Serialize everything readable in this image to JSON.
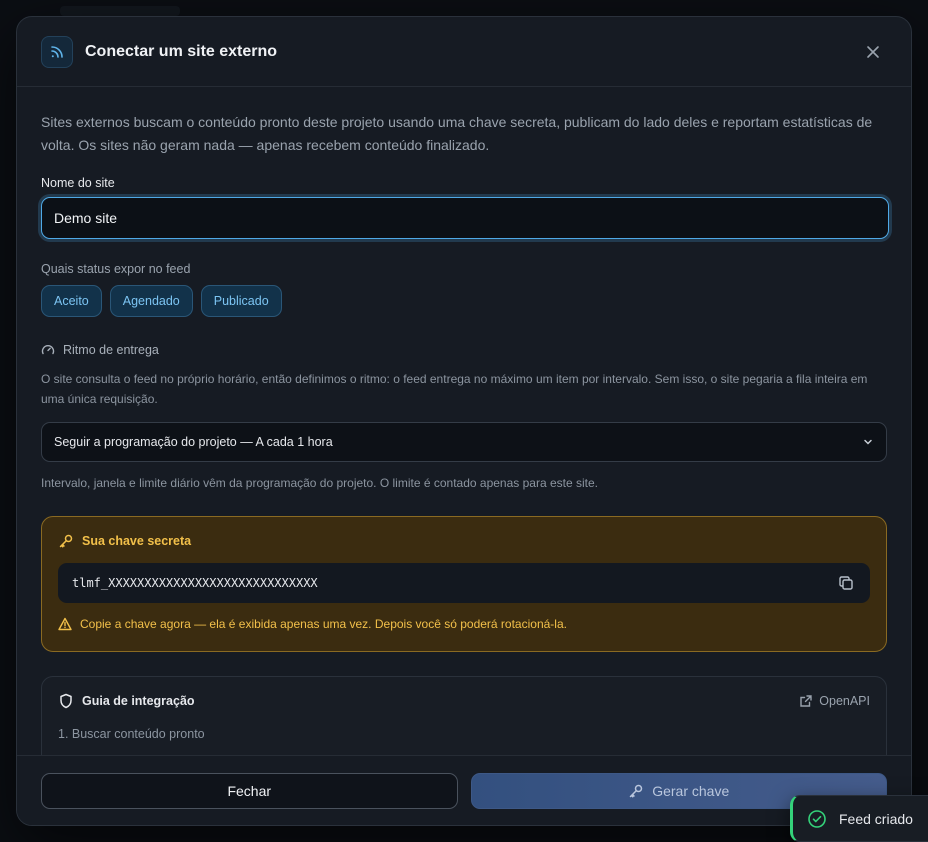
{
  "modal": {
    "title": "Conectar um site externo",
    "intro": "Sites externos buscam o conteúdo pronto deste projeto usando uma chave secreta, publicam do lado deles e reportam estatísticas de volta. Os sites não geram nada — apenas recebem conteúdo finalizado."
  },
  "site_name": {
    "label": "Nome do site",
    "value": "Demo site"
  },
  "status": {
    "label": "Quais status expor no feed",
    "chips": [
      "Aceito",
      "Agendado",
      "Publicado"
    ]
  },
  "pace": {
    "title": "Ritmo de entrega",
    "help": "O site consulta o feed no próprio horário, então definimos o ritmo: o feed entrega no máximo um item por intervalo. Sem isso, o site pegaria a fila inteira em uma única requisição.",
    "selected": "Seguir a programação do projeto — A cada 1 hora",
    "help2": "Intervalo, janela e limite diário vêm da programação do projeto. O limite é contado apenas para este site."
  },
  "secret_key": {
    "title": "Sua chave secreta",
    "value": "tlmf_XXXXXXXXXXXXXXXXXXXXXXXXXXXXX",
    "warning": "Copie a chave agora — ela é exibida apenas uma vez. Depois você só poderá rotacioná-la."
  },
  "guide": {
    "title": "Guia de integração",
    "openapi_label": "OpenAPI",
    "step1": "1. Buscar conteúdo pronto"
  },
  "footer": {
    "close_label": "Fechar",
    "generate_label": "Gerar chave"
  },
  "toast": {
    "message": "Feed criado"
  },
  "colors": {
    "accent": "#4fa9e6",
    "warning": "#f2c04a",
    "success": "#34d27a"
  }
}
